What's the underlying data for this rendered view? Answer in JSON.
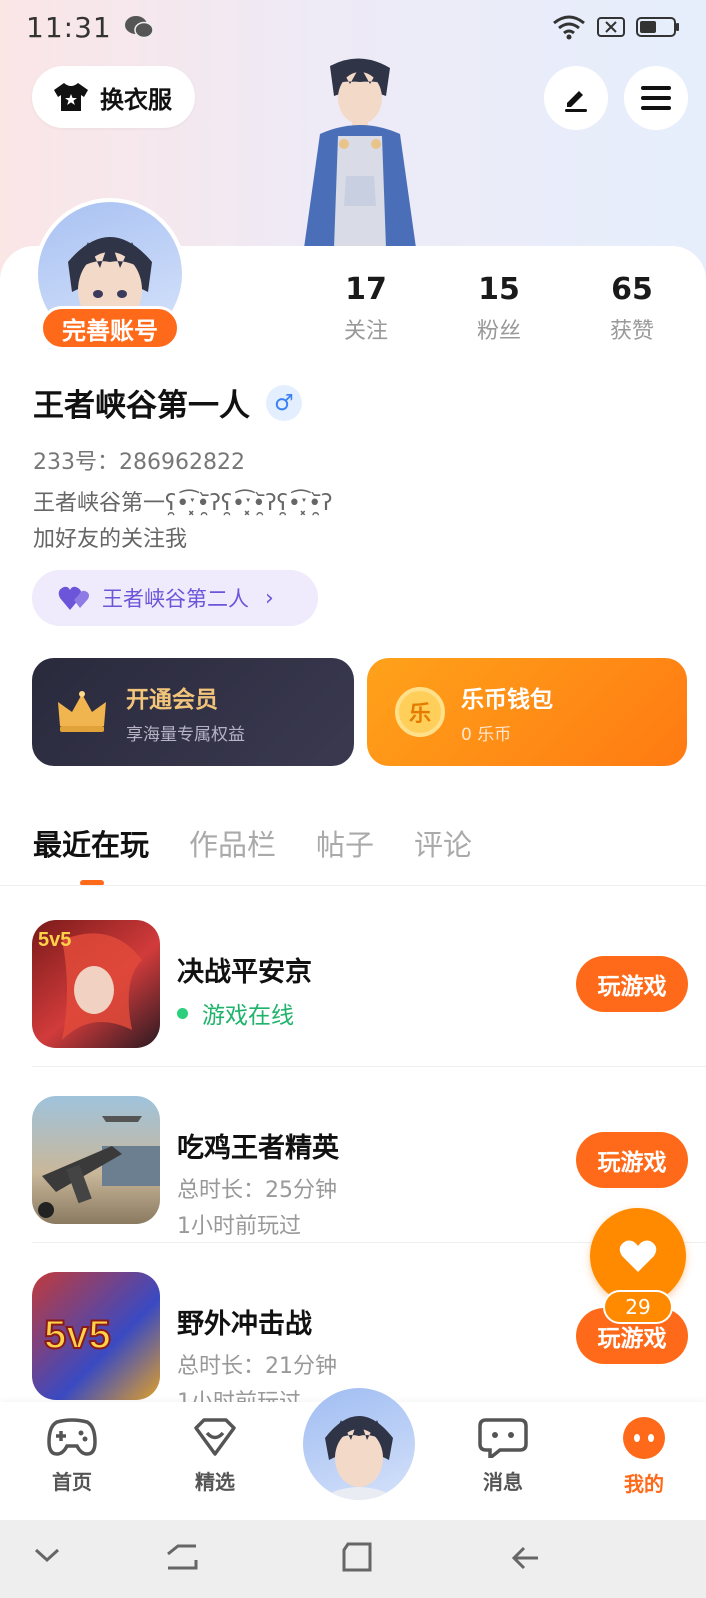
{
  "status_bar": {
    "time": "11:31"
  },
  "header": {
    "outfit_label": "换衣服"
  },
  "profile": {
    "complete_label": "完善账号",
    "stats": [
      {
        "num": "17",
        "label": "关注"
      },
      {
        "num": "15",
        "label": "粉丝"
      },
      {
        "num": "65",
        "label": "获赞"
      }
    ],
    "username": "王者峡谷第一人",
    "gender_symbol": "♂",
    "uid": "233号：286962822",
    "bio_line1": "王者峡谷第一ʕ̯•͡ˑ͓•̯᷅ʔʕ̯•͡ˑ͓•̯᷅ʔʕ̯•͡ˑ͓•̯᷅ʔ",
    "bio_line2": "加好友的关注我",
    "couple_label": "王者峡谷第二人"
  },
  "cards": {
    "vip_title": "开通会员",
    "vip_sub": "享海量专属权益",
    "wallet_title": "乐币钱包",
    "wallet_sub": "0 乐币",
    "wallet_coin_char": "乐"
  },
  "tabs": [
    "最近在玩",
    "作品栏",
    "帖子",
    "评论"
  ],
  "games": [
    {
      "name": "决战平安京",
      "status": "游戏在线",
      "button": "玩游戏",
      "thumb_text": "5v5"
    },
    {
      "name": "吃鸡王者精英",
      "line1": "总时长：25分钟",
      "line2": "1小时前玩过",
      "button": "玩游戏"
    },
    {
      "name": "野外冲击战",
      "line1": "总时长：21分钟",
      "line2": "1小时前玩过",
      "button": "玩游戏",
      "thumb_text": "5v5"
    }
  ],
  "float_like": {
    "count": "29"
  },
  "bottom_nav": [
    {
      "label": "首页"
    },
    {
      "label": "精选"
    },
    {
      "label": "消息"
    },
    {
      "label": "我的"
    }
  ],
  "colors": {
    "accent": "#ff6a1a",
    "online": "#1fb36b",
    "couple": "#6d55d9"
  }
}
